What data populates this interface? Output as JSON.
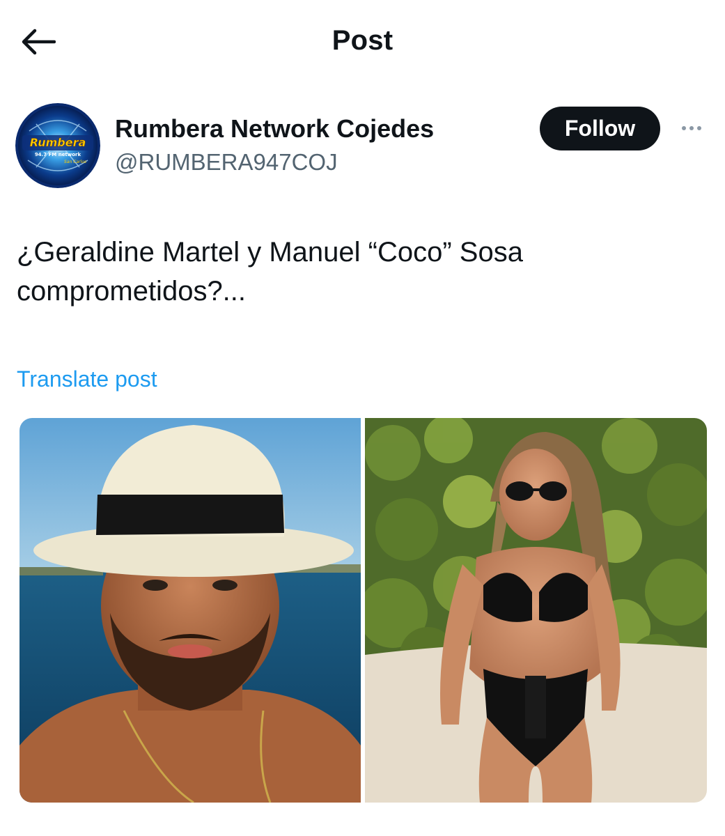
{
  "header": {
    "title": "Post",
    "back_icon": "arrow-left-icon"
  },
  "author": {
    "name": "Rumbera Network Cojedes",
    "handle": "@RUMBERA947COJ",
    "avatar": {
      "logo_text": "Rumbera",
      "logo_subtext": "94.7 FM network",
      "logo_location": "San Carlos"
    },
    "follow_label": "Follow",
    "more_icon": "more-horizontal-icon"
  },
  "post": {
    "text": "¿Geraldine Martel y Manuel “Coco” Sosa comprometidos?...",
    "translate_label": "Translate post",
    "media": [
      {
        "kind": "photo",
        "subject": "man in white panama hat by the sea"
      },
      {
        "kind": "photo",
        "subject": "woman in black bikini and sunglasses on beach with foliage"
      }
    ]
  },
  "colors": {
    "text_primary": "#0f1419",
    "text_secondary": "#536471",
    "link": "#1d9bf0",
    "follow_bg": "#0f1419",
    "follow_text": "#ffffff"
  }
}
